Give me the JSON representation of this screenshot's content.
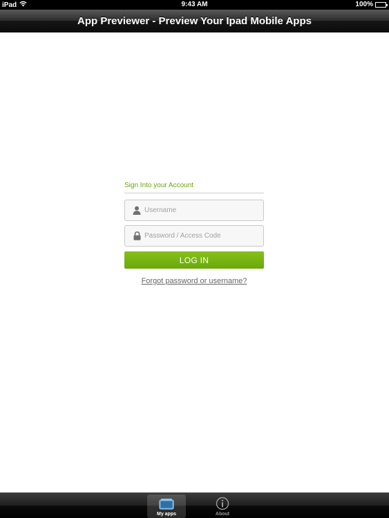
{
  "status_bar": {
    "carrier": "iPad",
    "time": "9:43 AM",
    "battery": "100%"
  },
  "nav_bar": {
    "title": "App Previewer - Preview Your Ipad Mobile Apps"
  },
  "login": {
    "heading": "Sign Into your Account",
    "username_placeholder": "Username",
    "password_placeholder": "Password / Access Code",
    "login_label": "LOG IN",
    "forgot_label": "Forgot password or username?"
  },
  "tab_bar": {
    "tabs": [
      {
        "label": "My apps",
        "icon": "my-apps-icon",
        "active": true
      },
      {
        "label": "About",
        "icon": "info-icon",
        "active": false
      }
    ]
  },
  "colors": {
    "accent": "#6aa60a",
    "bar": "#1a1a1a"
  }
}
